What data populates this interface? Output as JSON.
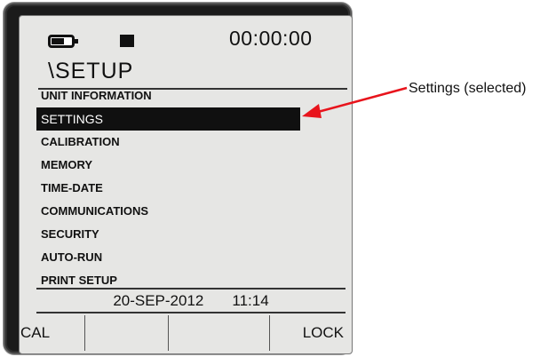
{
  "device": {
    "status": {
      "battery_icon": "battery-icon",
      "indicator_icon": "square-indicator-icon",
      "clock": "00:00:00"
    },
    "page_title": "\\SETUP",
    "menu": {
      "selected_index": 1,
      "items": [
        {
          "label": "UNIT INFORMATION"
        },
        {
          "label": "SETTINGS"
        },
        {
          "label": "CALIBRATION"
        },
        {
          "label": "MEMORY"
        },
        {
          "label": "TIME-DATE"
        },
        {
          "label": "COMMUNICATIONS"
        },
        {
          "label": "SECURITY"
        },
        {
          "label": "AUTO-RUN"
        },
        {
          "label": "PRINT SETUP"
        }
      ]
    },
    "date": "20-SEP-2012",
    "time": "11:14",
    "softkeys": [
      "CAL",
      "",
      "",
      "LOCK"
    ]
  },
  "annotation": {
    "label": "Settings (selected)",
    "arrow_color": "#e8141c"
  }
}
